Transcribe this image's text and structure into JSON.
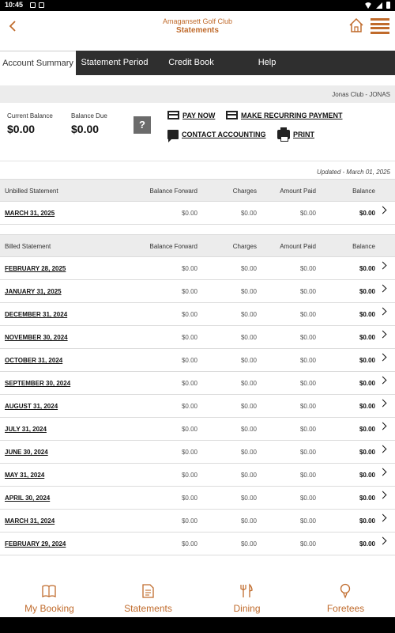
{
  "status": {
    "time": "10:45"
  },
  "header": {
    "club_name": "Amagansett Golf Club",
    "title": "Statements"
  },
  "tabs": [
    {
      "label": "Account Summary",
      "active": true
    },
    {
      "label": "Statement Period",
      "active": false
    },
    {
      "label": "Credit Book",
      "active": false
    },
    {
      "label": "Help",
      "active": false
    }
  ],
  "club_bar": {
    "text": "Jonas Club - JONAS"
  },
  "summary": {
    "current_balance_label": "Current Balance",
    "current_balance": "$0.00",
    "balance_due_label": "Balance Due",
    "balance_due": "$0.00",
    "help_glyph": "?"
  },
  "actions": {
    "pay_now": "PAY NOW",
    "recurring": "MAKE RECURRING PAYMENT",
    "contact": "CONTACT ACCOUNTING",
    "print": "PRINT"
  },
  "updated": "Updated - March 01, 2025",
  "unbilled": {
    "headers": [
      "Unbilled Statement",
      "Balance Forward",
      "Charges",
      "Amount Paid",
      "Balance"
    ],
    "rows": [
      {
        "date": "MARCH 31, 2025",
        "bf": "$0.00",
        "charges": "$0.00",
        "paid": "$0.00",
        "balance": "$0.00"
      }
    ]
  },
  "billed": {
    "headers": [
      "Billed Statement",
      "Balance Forward",
      "Charges",
      "Amount Paid",
      "Balance"
    ],
    "rows": [
      {
        "date": "FEBRUARY 28, 2025",
        "bf": "$0.00",
        "charges": "$0.00",
        "paid": "$0.00",
        "balance": "$0.00"
      },
      {
        "date": "JANUARY 31, 2025",
        "bf": "$0.00",
        "charges": "$0.00",
        "paid": "$0.00",
        "balance": "$0.00"
      },
      {
        "date": "DECEMBER 31, 2024",
        "bf": "$0.00",
        "charges": "$0.00",
        "paid": "$0.00",
        "balance": "$0.00"
      },
      {
        "date": "NOVEMBER 30, 2024",
        "bf": "$0.00",
        "charges": "$0.00",
        "paid": "$0.00",
        "balance": "$0.00"
      },
      {
        "date": "OCTOBER 31, 2024",
        "bf": "$0.00",
        "charges": "$0.00",
        "paid": "$0.00",
        "balance": "$0.00"
      },
      {
        "date": "SEPTEMBER 30, 2024",
        "bf": "$0.00",
        "charges": "$0.00",
        "paid": "$0.00",
        "balance": "$0.00"
      },
      {
        "date": "AUGUST 31, 2024",
        "bf": "$0.00",
        "charges": "$0.00",
        "paid": "$0.00",
        "balance": "$0.00"
      },
      {
        "date": "JULY 31, 2024",
        "bf": "$0.00",
        "charges": "$0.00",
        "paid": "$0.00",
        "balance": "$0.00"
      },
      {
        "date": "JUNE 30, 2024",
        "bf": "$0.00",
        "charges": "$0.00",
        "paid": "$0.00",
        "balance": "$0.00"
      },
      {
        "date": "MAY 31, 2024",
        "bf": "$0.00",
        "charges": "$0.00",
        "paid": "$0.00",
        "balance": "$0.00"
      },
      {
        "date": "APRIL 30, 2024",
        "bf": "$0.00",
        "charges": "$0.00",
        "paid": "$0.00",
        "balance": "$0.00"
      },
      {
        "date": "MARCH 31, 2024",
        "bf": "$0.00",
        "charges": "$0.00",
        "paid": "$0.00",
        "balance": "$0.00"
      },
      {
        "date": "FEBRUARY 29, 2024",
        "bf": "$0.00",
        "charges": "$0.00",
        "paid": "$0.00",
        "balance": "$0.00"
      }
    ]
  },
  "bottom_nav": [
    {
      "label": "My Booking",
      "icon": "book-icon"
    },
    {
      "label": "Statements",
      "icon": "document-icon"
    },
    {
      "label": "Dining",
      "icon": "utensils-icon"
    },
    {
      "label": "Foretees",
      "icon": "golf-ball-icon"
    }
  ],
  "colors": {
    "accent": "#c06b2c",
    "tab_bg": "#2f2f2f",
    "header_bg": "#ececec"
  }
}
